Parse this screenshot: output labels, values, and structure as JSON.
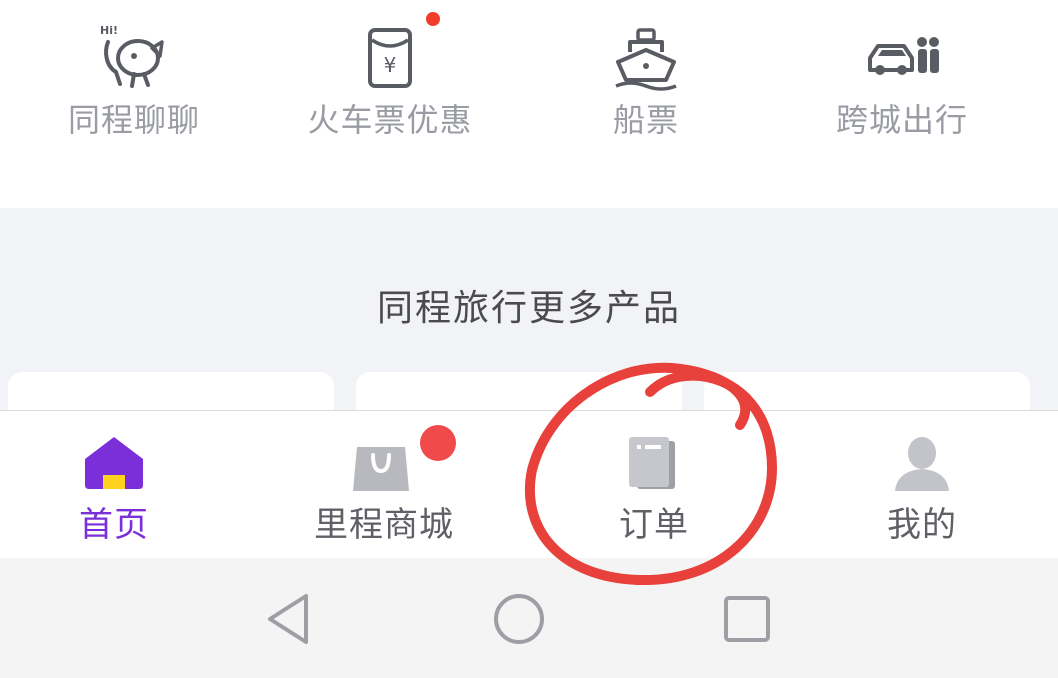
{
  "quick_access": [
    {
      "label": "同程聊聊",
      "icon": "chat-mascot-icon"
    },
    {
      "label": "火车票优惠",
      "icon": "red-envelope-icon",
      "badge": "red-dot"
    },
    {
      "label": "船票",
      "icon": "ship-icon"
    },
    {
      "label": "跨城出行",
      "icon": "car-people-icon"
    }
  ],
  "more_section": {
    "title": "同程旅行更多产品"
  },
  "tabbar": {
    "tabs": [
      {
        "label": "首页",
        "icon": "home-icon",
        "active": true
      },
      {
        "label": "里程商城",
        "icon": "shopping-bag-icon",
        "badge": "red-dot"
      },
      {
        "label": "订单",
        "icon": "order-notebook-icon"
      },
      {
        "label": "我的",
        "icon": "user-icon"
      }
    ]
  },
  "system_nav": {
    "buttons": [
      "back-icon",
      "home-circle-icon",
      "recents-square-icon"
    ]
  },
  "colors": {
    "accent": "#7b2fd8",
    "home_roof": "#7b2fd8",
    "home_door": "#ffd21f",
    "badge": "#f23d2c",
    "annotation": "#e8403a",
    "label_gray": "#9a9ca3",
    "section_bg": "#f2f3f6"
  }
}
